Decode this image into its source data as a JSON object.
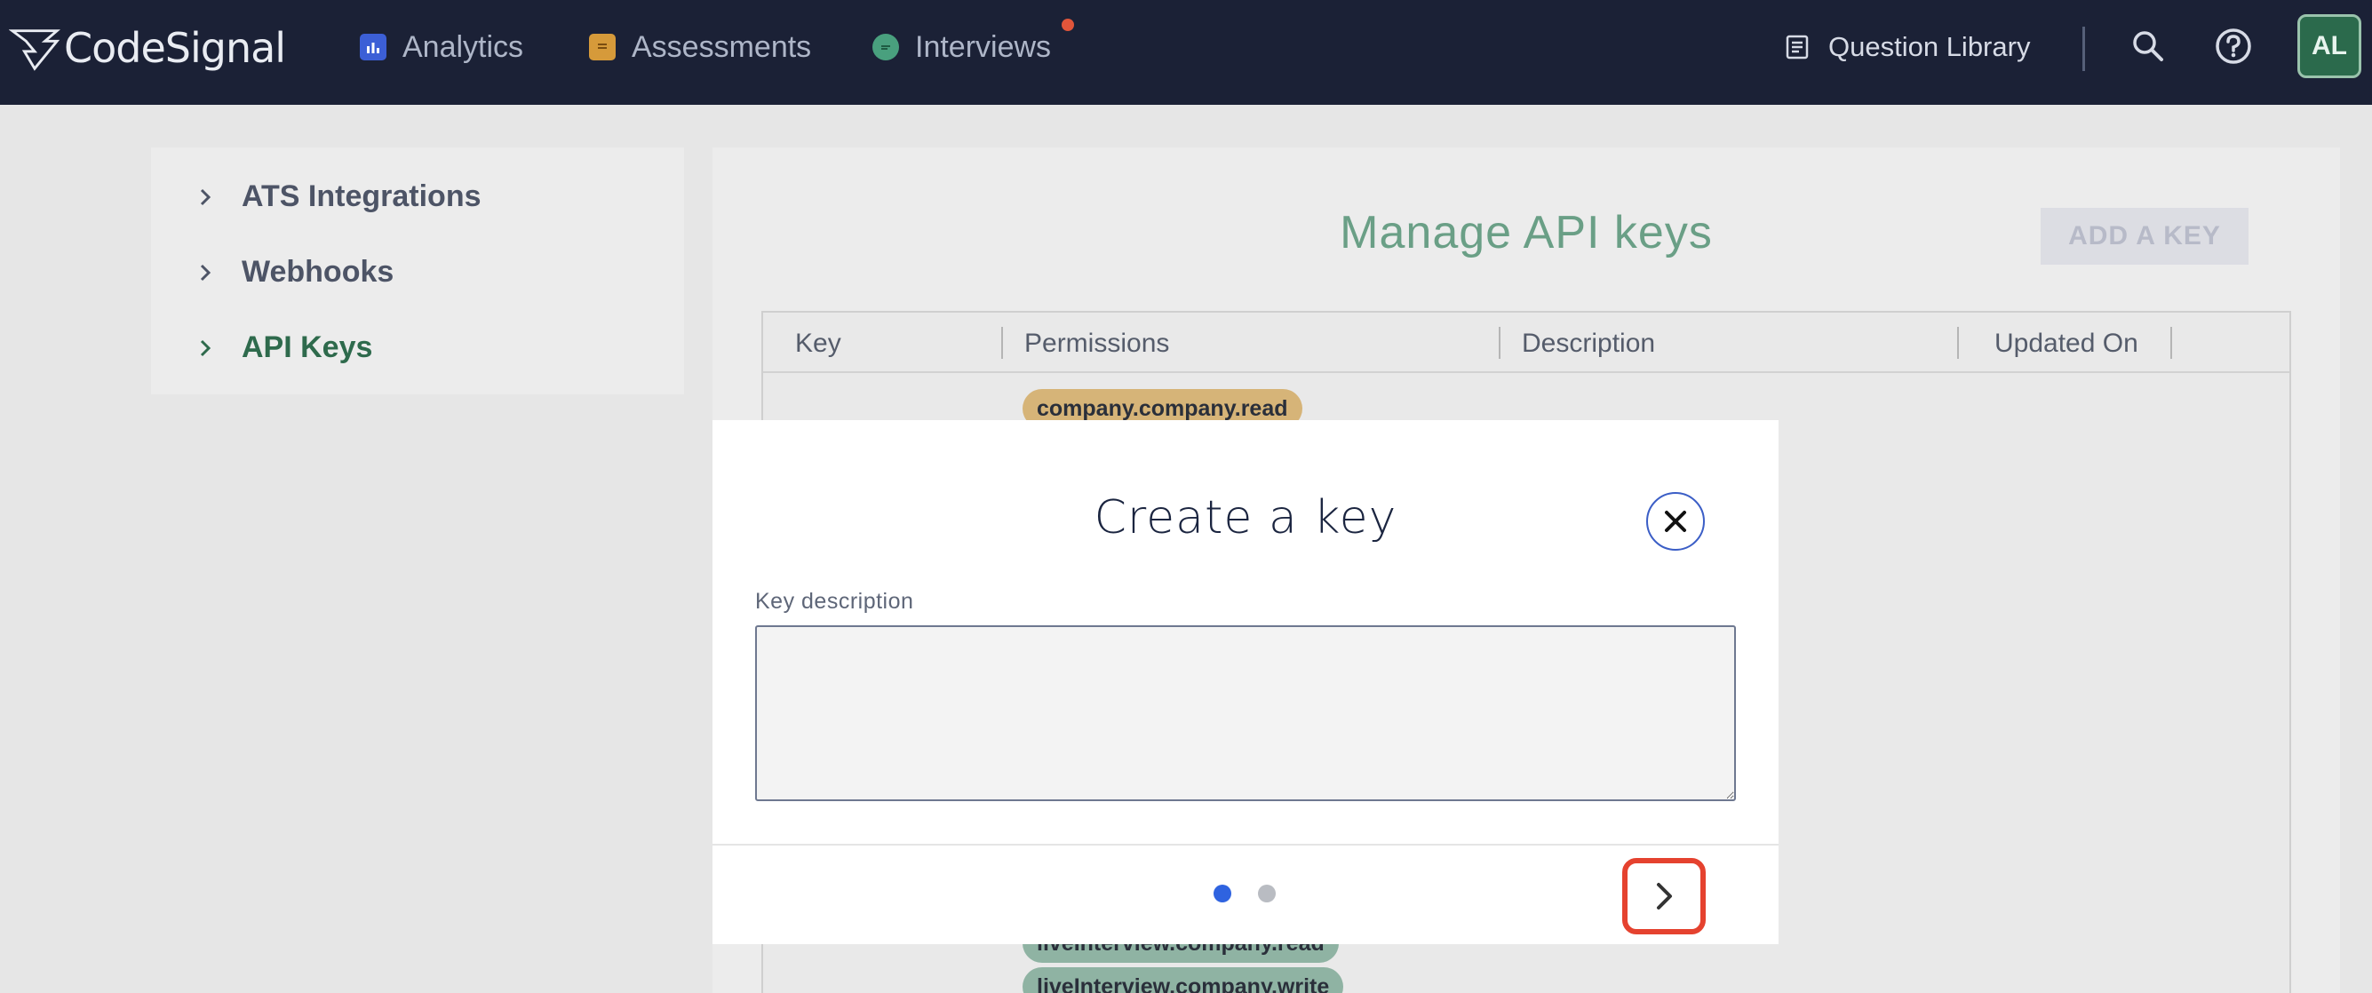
{
  "topbar": {
    "brand": "CodeSignal",
    "nav": [
      {
        "label": "Analytics",
        "icon": "analytics-icon"
      },
      {
        "label": "Assessments",
        "icon": "assessments-icon"
      },
      {
        "label": "Interviews",
        "icon": "interviews-icon"
      }
    ],
    "question_library": "Question Library",
    "avatar_initials": "AL"
  },
  "sidebar": {
    "items": [
      {
        "label": "ATS Integrations",
        "active": false
      },
      {
        "label": "Webhooks",
        "active": false
      },
      {
        "label": "API Keys",
        "active": true
      }
    ]
  },
  "main": {
    "title": "Manage API keys",
    "add_key_label": "ADD A KEY",
    "table": {
      "columns": [
        "Key",
        "Permissions",
        "Description",
        "Updated On"
      ],
      "visible_tags": [
        "company.company.read",
        "liveInterview.company.read",
        "liveInterview.company.write"
      ]
    }
  },
  "modal": {
    "title": "Create a key",
    "field_label": "Key description",
    "field_value": "",
    "steps_total": 2,
    "current_step": 1
  },
  "colors": {
    "topbar": "#1b2136",
    "accent_blue": "#2f63e0",
    "brand_green": "#2e6a4c",
    "highlight_red": "#e5422f"
  }
}
